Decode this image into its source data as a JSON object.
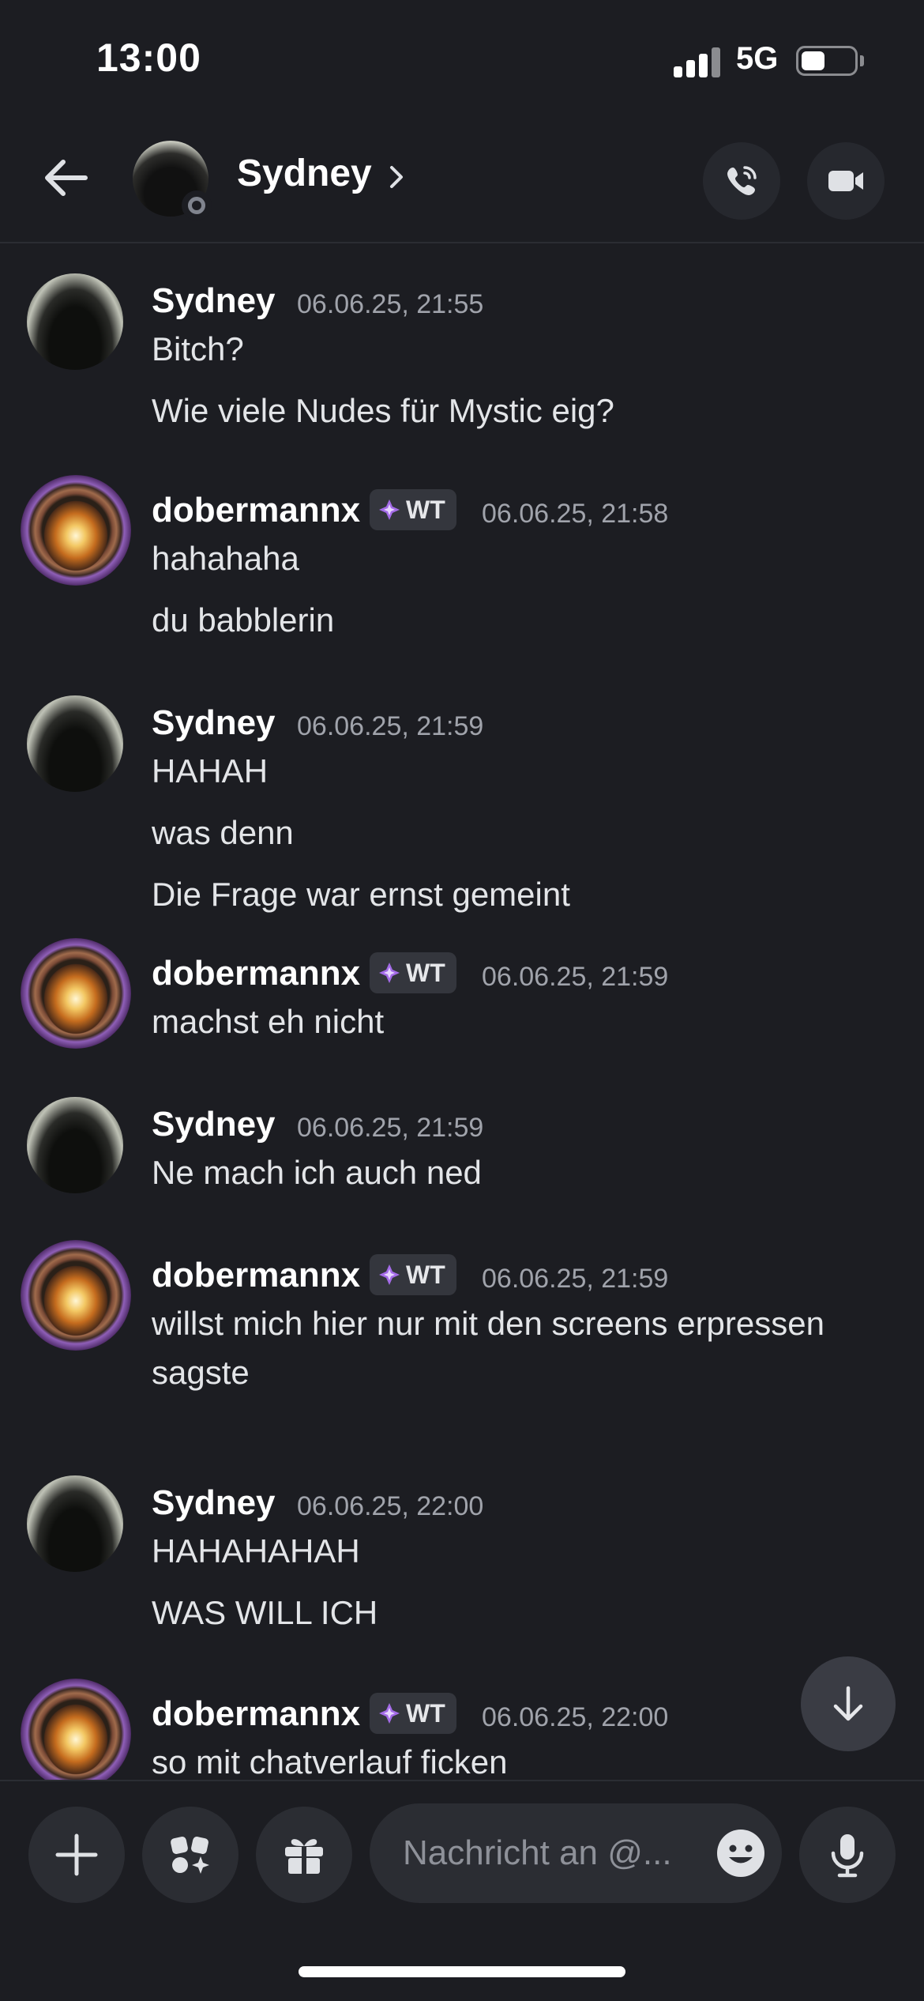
{
  "status_bar": {
    "time": "13:00",
    "network": "5G",
    "battery_level": 0.45
  },
  "header": {
    "name": "Sydney"
  },
  "messages": [
    {
      "author": "Sydney",
      "timestamp": "06.06.25, 21:55",
      "tag": null,
      "lines": [
        "Bitch?",
        "Wie viele Nudes für Mystic eig?"
      ]
    },
    {
      "author": "dobermannx",
      "timestamp": "06.06.25, 21:58",
      "tag": "WT",
      "lines": [
        "hahahaha",
        "du babblerin"
      ]
    },
    {
      "author": "Sydney",
      "timestamp": "06.06.25, 21:59",
      "tag": null,
      "lines": [
        "HAHAH",
        "was denn",
        "Die Frage war ernst gemeint"
      ]
    },
    {
      "author": "dobermannx",
      "timestamp": "06.06.25, 21:59",
      "tag": "WT",
      "lines": [
        "machst eh nicht"
      ]
    },
    {
      "author": "Sydney",
      "timestamp": "06.06.25, 21:59",
      "tag": null,
      "lines": [
        "Ne mach ich auch ned"
      ]
    },
    {
      "author": "dobermannx",
      "timestamp": "06.06.25, 21:59",
      "tag": "WT",
      "lines": [
        "willst mich hier nur mit den screens erpressen",
        "sagste"
      ]
    },
    {
      "author": "Sydney",
      "timestamp": "06.06.25, 22:00",
      "tag": null,
      "lines": [
        "HAHAHAHAH",
        "WAS WILL ICH"
      ]
    },
    {
      "author": "dobermannx",
      "timestamp": "06.06.25, 22:00",
      "tag": "WT",
      "lines": [
        "so mit chatverlauf ficken"
      ]
    }
  ],
  "composer": {
    "placeholder": "Nachricht an @..."
  },
  "icons": {
    "back": "arrow-left-icon",
    "call": "phone-call-icon",
    "video": "video-camera-icon",
    "add": "plus-icon",
    "apps": "apps-icon",
    "gift": "gift-icon",
    "emoji": "emoji-icon",
    "mic": "microphone-icon",
    "scroll": "arrow-down-icon",
    "tag_gem": "gem-icon"
  },
  "colors": {
    "background": "#1c1d22",
    "tag_gem": "#a46be8",
    "status_offline": "#80848e"
  }
}
